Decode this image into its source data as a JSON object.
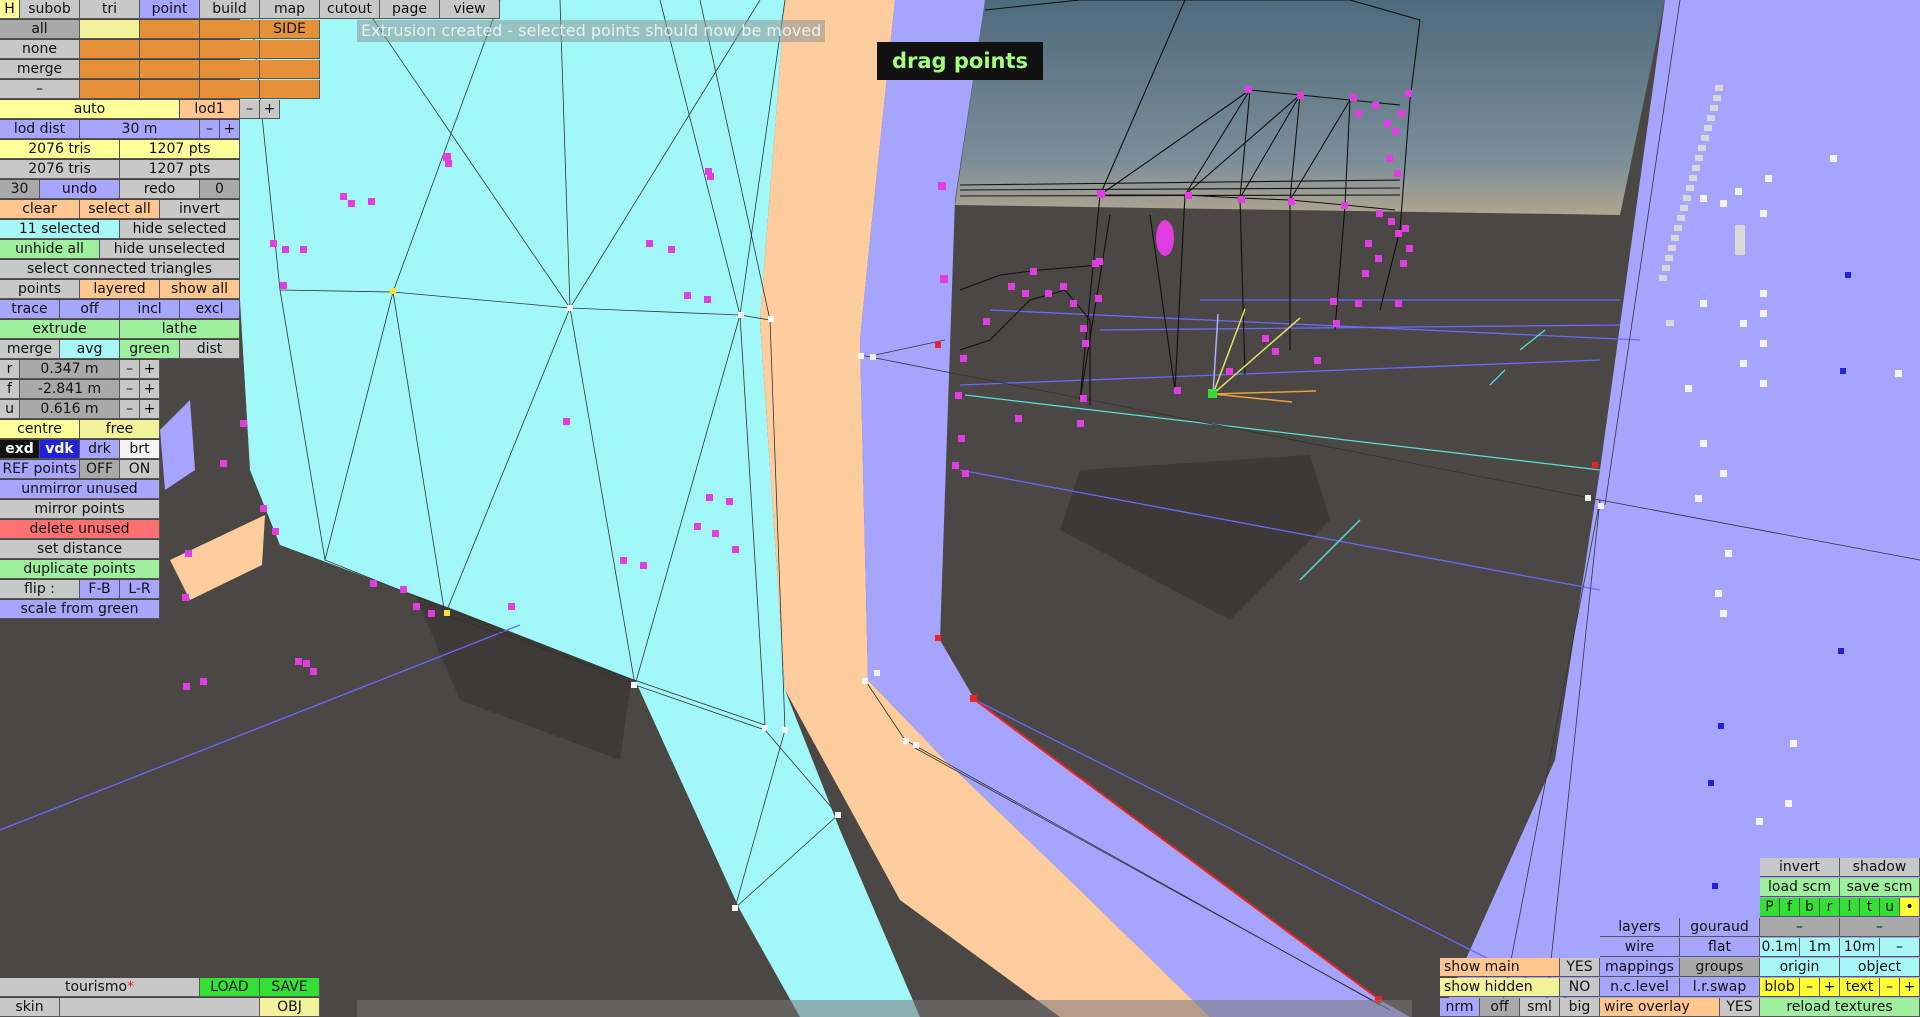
{
  "status_message": "Extrusion created - selected points should now be moved",
  "mode_banner": "drag points",
  "top_menu": [
    "H",
    "subob",
    "tri",
    "point",
    "build",
    "map",
    "cutout",
    "page",
    "view"
  ],
  "top_menu_active": "point",
  "sel_rows": [
    "all",
    "none",
    "merge",
    "–"
  ],
  "side_label": "SIDE",
  "lod": {
    "auto": "auto",
    "lod1": "lod1",
    "minus": "–",
    "plus": "+",
    "dist_label": "lod dist",
    "dist_value": "30 m",
    "dist_minus": "–",
    "dist_plus": "+"
  },
  "stats": {
    "tris1": "2076 tris",
    "pts1": "1207 pts",
    "tris2": "2076 tris",
    "pts2": "1207 pts"
  },
  "undo": {
    "count": "30",
    "undo": "undo",
    "redo": "redo",
    "redo_count": "0"
  },
  "selection": {
    "clear": "clear",
    "select_all": "select all",
    "invert": "invert",
    "selected": "11 selected",
    "hide_selected": "hide selected",
    "unhide_all": "unhide all",
    "hide_unselected": "hide unselected",
    "select_connected": "select connected triangles"
  },
  "points_row": {
    "points": "points",
    "layered": "layered",
    "show_all": "show all"
  },
  "trace_row": {
    "trace": "trace",
    "off": "off",
    "incl": "incl",
    "excl": "excl"
  },
  "extrude_row": {
    "extrude": "extrude",
    "lathe": "lathe"
  },
  "merge_row": {
    "merge": "merge",
    "avg": "avg",
    "green": "green",
    "dist": "dist"
  },
  "coords": [
    {
      "axis": "r",
      "value": "0.347 m",
      "minus": "–",
      "plus": "+"
    },
    {
      "axis": "f",
      "value": "-2.841 m",
      "minus": "–",
      "plus": "+"
    },
    {
      "axis": "u",
      "value": "0.616 m",
      "minus": "–",
      "plus": "+"
    }
  ],
  "centre_row": {
    "centre": "centre",
    "free": "free"
  },
  "view_row": {
    "exd": "exd",
    "vdk": "vdk",
    "drk": "drk",
    "brt": "brt"
  },
  "ref_row": {
    "ref": "REF points",
    "off": "OFF",
    "on": "ON"
  },
  "actions": {
    "unmirror": "unmirror unused",
    "mirror": "mirror points",
    "delete": "delete unused",
    "set_distance": "set distance",
    "duplicate": "duplicate points"
  },
  "flip_row": {
    "flip": "flip :",
    "fb": "F-B",
    "lr": "L-R"
  },
  "scale_green": "scale from green",
  "file": {
    "name": "tourismo",
    "dirty": "*",
    "load": "LOAD",
    "save": "SAVE",
    "skin": "skin",
    "obj": "OBJ"
  },
  "br_panel": {
    "invert": "invert",
    "shadow": "shadow",
    "load_scm": "load scm",
    "save_scm": "save scm",
    "toggles": [
      "P",
      "f",
      "b",
      "r",
      "l",
      "t",
      "u",
      "•"
    ],
    "dash1": "–",
    "dash2": "–",
    "layers": "layers",
    "gouraud": "gouraud",
    "wire": "wire",
    "flat": "flat",
    "g01": "0.1m",
    "g1": "1m",
    "g10": "10m",
    "gdash": "–",
    "show_main": "show main",
    "show_main_val": "YES",
    "mappings": "mappings",
    "groups": "groups",
    "origin": "origin",
    "object": "object",
    "show_hidden": "show hidden",
    "show_hidden_val": "NO",
    "nclevel": "n.c.level",
    "lrswap": "l.r.swap",
    "blob": "blob",
    "blob_minus": "–",
    "blob_plus": "+",
    "text": "text",
    "text_minus": "–",
    "text_plus": "+",
    "nrm": "nrm",
    "off": "off",
    "sml": "sml",
    "big": "big",
    "wire_overlay": "wire overlay",
    "wire_overlay_val": "YES",
    "reload": "reload textures"
  },
  "colors": {
    "cyan_surface": "#a2f8f8",
    "blue_surface": "#a5a5ff",
    "orange_surface": "#fecd9e",
    "ground": "#4a4744",
    "vertex": "#e13de1"
  }
}
